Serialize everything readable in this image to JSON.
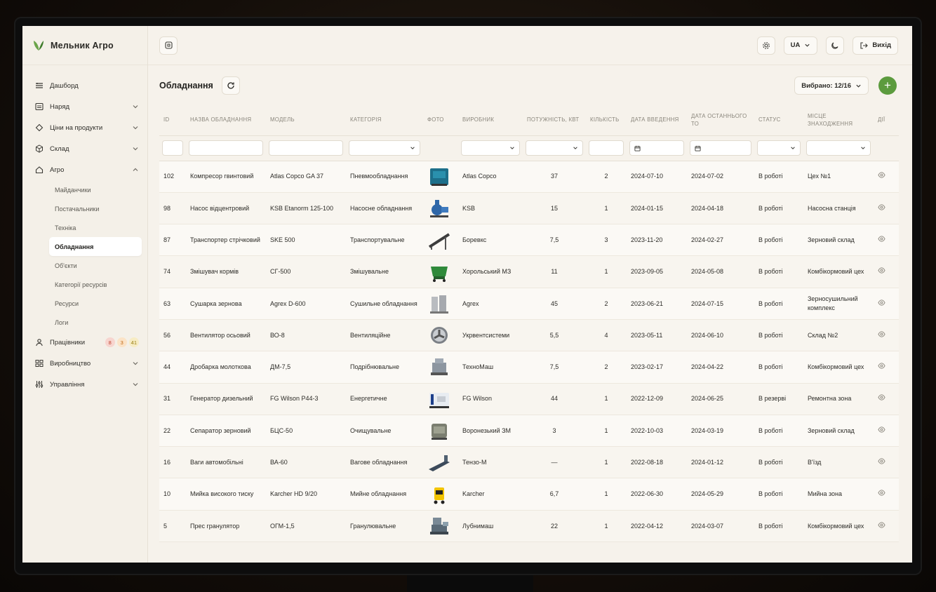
{
  "app": {
    "brand": "Мельник Агро"
  },
  "topbar": {
    "language": "UA",
    "logout_label": "Вихід"
  },
  "sidebar": {
    "items": [
      {
        "label": "Дашборд",
        "icon": "dashboard-icon"
      },
      {
        "label": "Наряд",
        "icon": "list-icon",
        "expandable": true
      },
      {
        "label": "Ціни на продукти",
        "icon": "tag-icon",
        "expandable": true
      },
      {
        "label": "Склад",
        "icon": "box-icon",
        "expandable": true
      },
      {
        "label": "Агро",
        "icon": "home-icon",
        "expanded": true
      }
    ],
    "agro_sub": [
      {
        "label": "Майданчики"
      },
      {
        "label": "Постачальники"
      },
      {
        "label": "Техніка"
      },
      {
        "label": "Обладнання",
        "active": true
      },
      {
        "label": "Об'єкти"
      },
      {
        "label": "Категорії ресурсів"
      },
      {
        "label": "Ресурси"
      },
      {
        "label": "Логи"
      }
    ],
    "workers": {
      "label": "Працівники",
      "badges": [
        "8",
        "3",
        "41"
      ]
    },
    "production": {
      "label": "Виробництво"
    },
    "management": {
      "label": "Управління"
    }
  },
  "page": {
    "title": "Обладнання",
    "selected_label": "Вибрано: 12/16"
  },
  "table": {
    "columns": [
      "ID",
      "Назва обладнання",
      "Модель",
      "Категорія",
      "Фото",
      "Виробник",
      "Потужність, кВт",
      "Кількість",
      "Дата введення",
      "Дата останнього ТО",
      "Статус",
      "Місце знаходження",
      "Дії"
    ],
    "rows": [
      {
        "id": "102",
        "name": "Компресор гвинтовий",
        "model": "Atlas Copco GA 37",
        "category": "Пневмообладнання",
        "photo": "compressor",
        "maker": "Atlas Copco",
        "power": "37",
        "qty": "2",
        "date_in": "2024-07-10",
        "date_to": "2024-07-02",
        "status": "В роботі",
        "place": "Цех №1"
      },
      {
        "id": "98",
        "name": "Насос відцентровий",
        "model": "KSB Etanorm 125-100",
        "category": "Насосне обладнання",
        "photo": "pump",
        "maker": "KSB",
        "power": "15",
        "qty": "1",
        "date_in": "2024-01-15",
        "date_to": "2024-04-18",
        "status": "В роботі",
        "place": "Насосна станція"
      },
      {
        "id": "87",
        "name": "Транспортер стрічковий",
        "model": "SKE 500",
        "category": "Транспортувальне",
        "photo": "conveyor",
        "maker": "Боревкс",
        "power": "7,5",
        "qty": "3",
        "date_in": "2023-11-20",
        "date_to": "2024-02-27",
        "status": "В роботі",
        "place": "Зерновий склад"
      },
      {
        "id": "74",
        "name": "Змішувач кормів",
        "model": "СГ-500",
        "category": "Змішувальне",
        "photo": "mixer",
        "maker": "Хорольський МЗ",
        "power": "11",
        "qty": "1",
        "date_in": "2023-09-05",
        "date_to": "2024-05-08",
        "status": "В роботі",
        "place": "Комбікормовий цех"
      },
      {
        "id": "63",
        "name": "Сушарка зернова",
        "model": "Agrex D-600",
        "category": "Сушильне обладнання",
        "photo": "dryer",
        "maker": "Agrex",
        "power": "45",
        "qty": "2",
        "date_in": "2023-06-21",
        "date_to": "2024-07-15",
        "status": "В роботі",
        "place": "Зерносушильний комплекс"
      },
      {
        "id": "56",
        "name": "Вентилятор осьовий",
        "model": "ВО-8",
        "category": "Вентиляційне",
        "photo": "fan",
        "maker": "Укрвентсистеми",
        "power": "5,5",
        "qty": "4",
        "date_in": "2023-05-11",
        "date_to": "2024-06-10",
        "status": "В роботі",
        "place": "Склад №2"
      },
      {
        "id": "44",
        "name": "Дробарка молоткова",
        "model": "ДМ-7,5",
        "category": "Подрібнювальне",
        "photo": "crusher",
        "maker": "ТехноМаш",
        "power": "7,5",
        "qty": "2",
        "date_in": "2023-02-17",
        "date_to": "2024-04-22",
        "status": "В роботі",
        "place": "Комбікормовий цех"
      },
      {
        "id": "31",
        "name": "Генератор дизельний",
        "model": "FG Wilson P44-3",
        "category": "Енергетичне",
        "photo": "generator",
        "maker": "FG Wilson",
        "power": "44",
        "qty": "1",
        "date_in": "2022-12-09",
        "date_to": "2024-06-25",
        "status": "В резерві",
        "place": "Ремонтна зона"
      },
      {
        "id": "22",
        "name": "Сепаратор зерновий",
        "model": "БЦС-50",
        "category": "Очищувальне",
        "photo": "separator",
        "maker": "Воронезький ЗМ",
        "power": "3",
        "qty": "1",
        "date_in": "2022-10-03",
        "date_to": "2024-03-19",
        "status": "В роботі",
        "place": "Зерновий склад"
      },
      {
        "id": "16",
        "name": "Ваги автомобільні",
        "model": "ВА-60",
        "category": "Вагове обладнання",
        "photo": "scale",
        "maker": "Тензо-М",
        "power": "—",
        "qty": "1",
        "date_in": "2022-08-18",
        "date_to": "2024-01-12",
        "status": "В роботі",
        "place": "В'їзд"
      },
      {
        "id": "10",
        "name": "Мийка високого тиску",
        "model": "Karcher HD 9/20",
        "category": "Мийне обладнання",
        "photo": "washer",
        "maker": "Karcher",
        "power": "6,7",
        "qty": "1",
        "date_in": "2022-06-30",
        "date_to": "2024-05-29",
        "status": "В роботі",
        "place": "Мийна зона"
      },
      {
        "id": "5",
        "name": "Прес гранулятор",
        "model": "ОГМ-1,5",
        "category": "Гранулювальне",
        "photo": "press",
        "maker": "Лубнимаш",
        "power": "22",
        "qty": "1",
        "date_in": "2022-04-12",
        "date_to": "2024-03-07",
        "status": "В роботі",
        "place": "Комбікормовий цех"
      }
    ]
  },
  "colors": {
    "accent": "#5c9b3e",
    "background": "#f6f2eb"
  }
}
